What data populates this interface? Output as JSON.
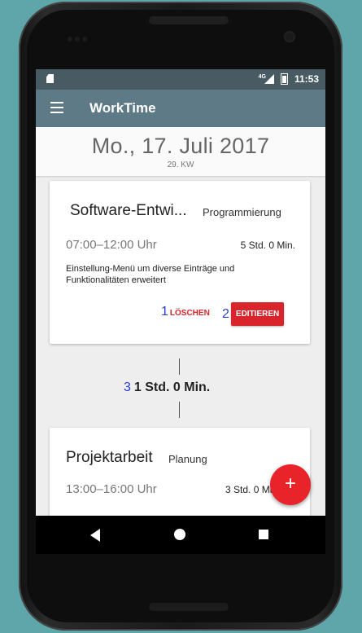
{
  "statusbar": {
    "network": "4G",
    "time": "11:53"
  },
  "appbar": {
    "title": "WorkTime"
  },
  "header": {
    "date": "Mo., 17. Juli 2017",
    "week": "29. KW"
  },
  "entries": [
    {
      "title": "Software-Entwi...",
      "category": "Programmierung",
      "time": "07:00–12:00 Uhr",
      "duration": "5 Std. 0 Min.",
      "description": "Einstellung-Menü um diverse Einträge und Funktionalitäten erweitert",
      "delete_label": "LÖSCHEN",
      "edit_label": "EDITIEREN"
    },
    {
      "title": "Projektarbeit",
      "category": "Planung",
      "time": "13:00–16:00 Uhr",
      "duration": "3 Std. 0 Min."
    }
  ],
  "break": {
    "label": "1 Std. 0 Min."
  },
  "annotations": {
    "n1": "1",
    "n2": "2",
    "n3": "3"
  },
  "fab": {
    "label": "+"
  },
  "colors": {
    "appbar": "#5e7a86",
    "statusbar": "#485b63",
    "accent": "#d8242a",
    "annotation": "#2a3bd6"
  },
  "icons": [
    "menu-icon",
    "sd-card-icon",
    "signal-icon",
    "battery-icon",
    "back-icon",
    "home-icon",
    "recent-apps-icon"
  ]
}
